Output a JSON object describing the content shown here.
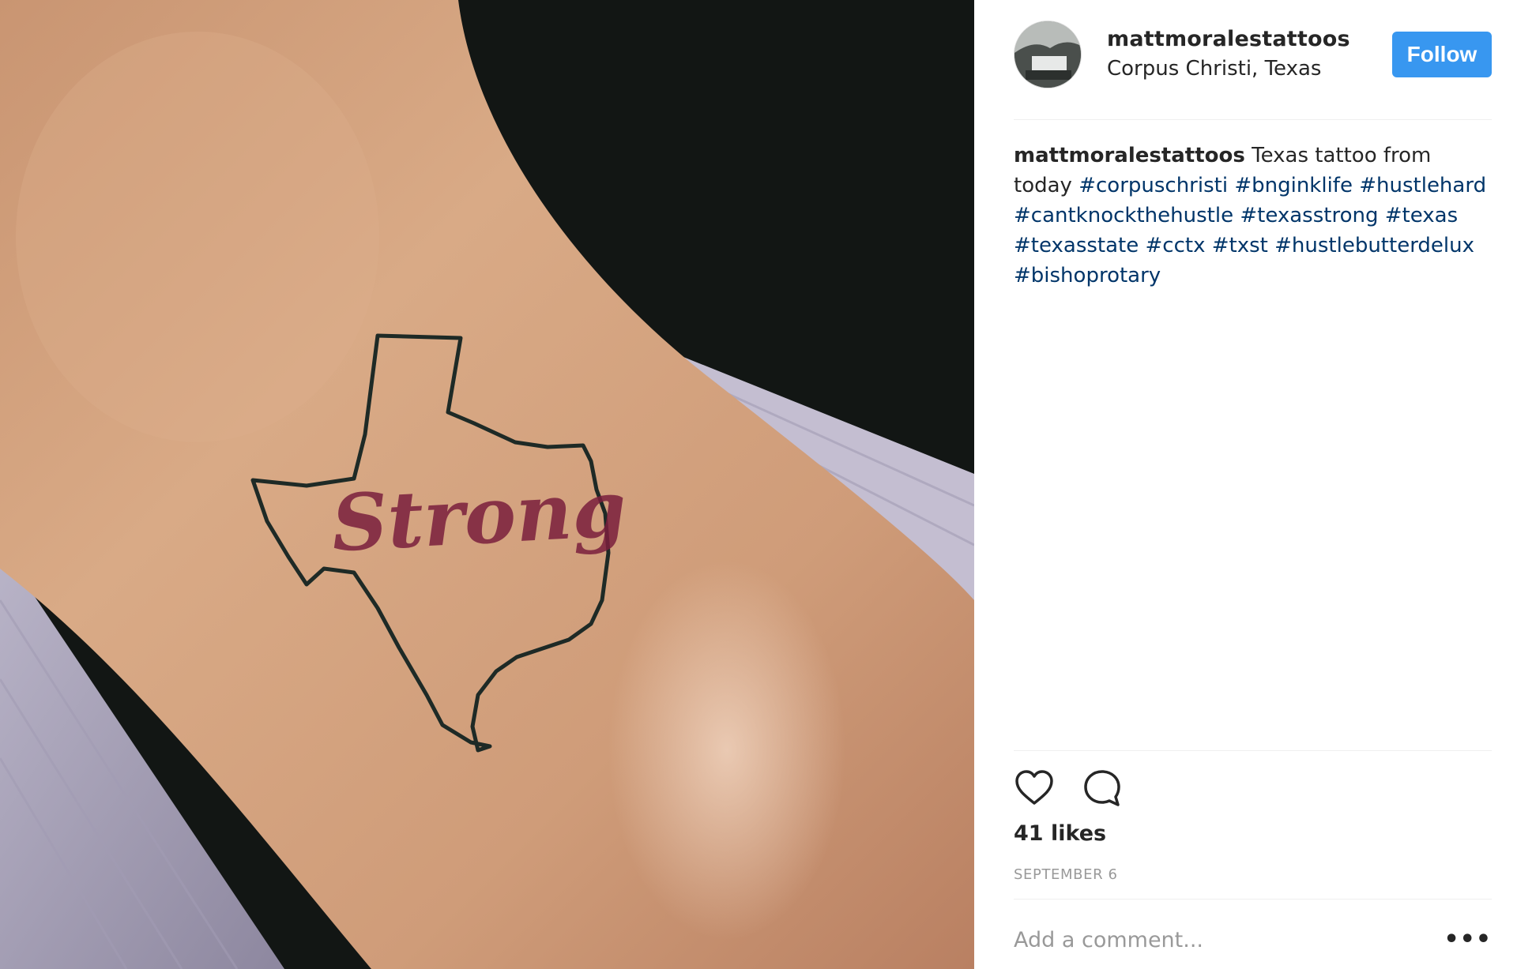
{
  "post": {
    "username": "mattmoralestattoos",
    "location": "Corpus Christi, Texas",
    "follow_label": "Follow",
    "caption": {
      "username": "mattmoralestattoos",
      "text": "Texas tattoo from today",
      "hashtags": [
        "#corpuschristi",
        "#bnginklife",
        "#hustlehard",
        "#cantknockthehustle",
        "#texasstrong",
        "#texas",
        "#texasstate",
        "#cctx",
        "#txst",
        "#hustlebutterdelux",
        "#bishoprotary"
      ]
    },
    "likes": "41 likes",
    "date": "SEPTEMBER 6",
    "comment_placeholder": "Add a comment...",
    "more_label": "•••",
    "photo": {
      "tattoo_word": "Strong"
    }
  },
  "colors": {
    "follow_button": "#3897f0",
    "hashtag": "#003569",
    "muted_text": "#999999",
    "tattoo_outline": "#1e2a26",
    "tattoo_script": "#7a1f3d"
  },
  "icons": {
    "like": "heart-outline-icon",
    "comment": "speech-bubble-icon",
    "more": "ellipsis-icon"
  }
}
